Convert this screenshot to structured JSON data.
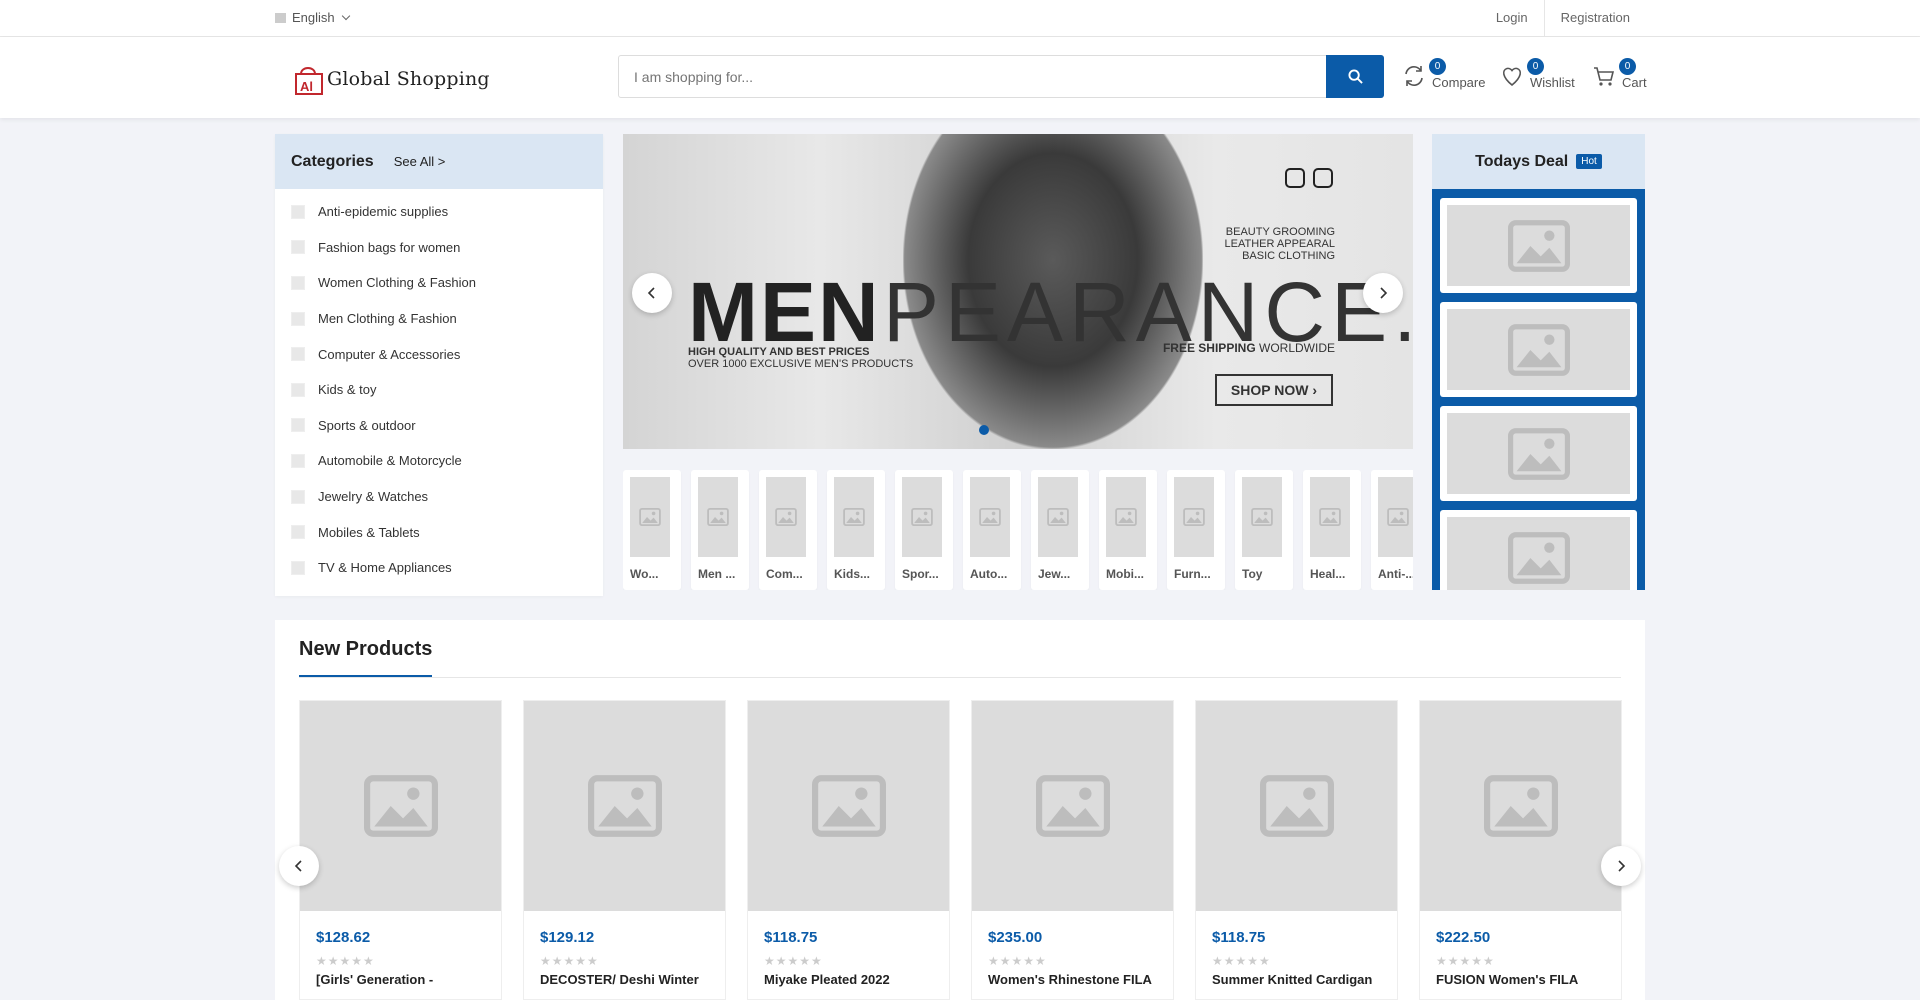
{
  "topbar": {
    "language": "English",
    "login": "Login",
    "registration": "Registration"
  },
  "header": {
    "logo_text": "Global Shopping",
    "search_placeholder": "I am shopping for...",
    "compare": {
      "label": "Compare",
      "count": "0"
    },
    "wishlist": {
      "label": "Wishlist",
      "count": "0"
    },
    "cart": {
      "label": "Cart",
      "count": "0"
    }
  },
  "categories": {
    "title": "Categories",
    "see_all": "See All >",
    "items": [
      "Anti-epidemic supplies",
      "Fashion bags for women",
      "Women Clothing & Fashion",
      "Men Clothing & Fashion",
      "Computer & Accessories",
      "Kids & toy",
      "Sports & outdoor",
      "Automobile & Motorcycle",
      "Jewelry & Watches",
      "Mobiles & Tablets",
      "TV & Home Appliances"
    ]
  },
  "banner": {
    "headline_bold": "MEN",
    "headline_light": "PEARANCE.",
    "sub_bold": "HIGH QUALITY AND BEST PRICES",
    "sub_line": "OVER 1000 EXCLUSIVE MEN'S PRODUCTS",
    "right_lines": [
      "BEAUTY GROOMING",
      "LEATHER APPEARAL",
      "BASIC CLOTHING"
    ],
    "free_shipping_bold": "FREE SHIPPING",
    "free_shipping_rest": " WORLDWIDE",
    "shop_now": "SHOP NOW"
  },
  "thumbs": [
    "Wo...",
    "Men ...",
    "Com...",
    "Kids...",
    "Spor...",
    "Auto...",
    "Jew...",
    "Mobi...",
    "Furn...",
    "Toy",
    "Heal...",
    "Anti-..."
  ],
  "todays_deal": {
    "title": "Todays Deal",
    "badge": "Hot"
  },
  "new_products": {
    "title": "New Products",
    "items": [
      {
        "price": "$128.62",
        "name": "[Girls' Generation -"
      },
      {
        "price": "$129.12",
        "name": "DECOSTER/ Deshi Winter"
      },
      {
        "price": "$118.75",
        "name": "Miyake Pleated 2022"
      },
      {
        "price": "$235.00",
        "name": "Women's Rhinestone FILA"
      },
      {
        "price": "$118.75",
        "name": "Summer Knitted Cardigan"
      },
      {
        "price": "$222.50",
        "name": "FUSION Women's FILA"
      }
    ]
  },
  "colors": {
    "brand": "#0b5ba8",
    "category_header": "#dae6f3"
  }
}
